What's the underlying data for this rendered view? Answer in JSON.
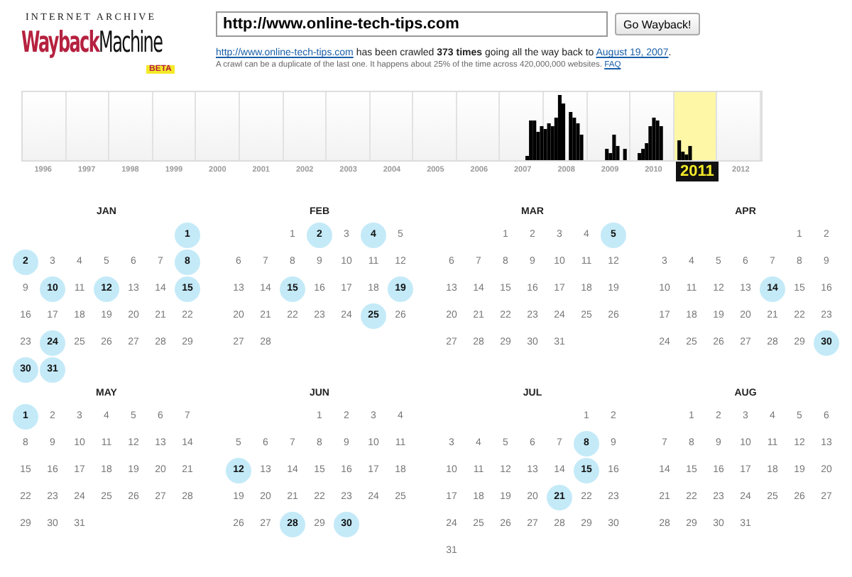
{
  "logo": {
    "top": "INTERNET ARCHIVE",
    "word_1": "Wayback",
    "word_2": "Machine",
    "badge": "BETA"
  },
  "search": {
    "value": "http://www.online-tech-tips.com",
    "button": "Go Wayback!"
  },
  "summary": {
    "url_link": "http://www.online-tech-tips.com",
    "text": " has been crawled **373 times** going all the way back to ",
    "date_link": "August 19, 2007",
    "end": "."
  },
  "note": {
    "text": "A crawl can be a duplicate of the last one. It happens about 25% of the time across 420,000,000 websites. ",
    "link": "FAQ"
  },
  "timeline": {
    "years": [
      {
        "label": "1996",
        "selected": false
      },
      {
        "label": "1997",
        "selected": false
      },
      {
        "label": "1998",
        "selected": false
      },
      {
        "label": "1999",
        "selected": false
      },
      {
        "label": "2000",
        "selected": false
      },
      {
        "label": "2001",
        "selected": false
      },
      {
        "label": "2002",
        "selected": false
      },
      {
        "label": "2003",
        "selected": false
      },
      {
        "label": "2004",
        "selected": false
      },
      {
        "label": "2005",
        "selected": false
      },
      {
        "label": "2006",
        "selected": false
      },
      {
        "label": "2007",
        "selected": false
      },
      {
        "label": "2008",
        "selected": false
      },
      {
        "label": "2009",
        "selected": false
      },
      {
        "label": "2010",
        "selected": false
      },
      {
        "label": "2011",
        "selected": true
      },
      {
        "label": "2012",
        "selected": false
      }
    ]
  },
  "months": [
    {
      "name": "JAN",
      "weeks": [
        {
          "kind": "first",
          "days": [
            {
              "day": "1",
              "crawled": true
            }
          ]
        },
        {
          "kind": "regular",
          "days": [
            {
              "day": "2",
              "crawled": true
            },
            {
              "day": "3",
              "crawled": false
            },
            {
              "day": "4",
              "crawled": false
            },
            {
              "day": "5",
              "crawled": false
            },
            {
              "day": "6",
              "crawled": false
            },
            {
              "day": "7",
              "crawled": false
            },
            {
              "day": "8",
              "crawled": true
            }
          ]
        },
        {
          "kind": "regular",
          "days": [
            {
              "day": "9",
              "crawled": false
            },
            {
              "day": "10",
              "crawled": true
            },
            {
              "day": "11",
              "crawled": false
            },
            {
              "day": "12",
              "crawled": true
            },
            {
              "day": "13",
              "crawled": false
            },
            {
              "day": "14",
              "crawled": false
            },
            {
              "day": "15",
              "crawled": true
            }
          ]
        },
        {
          "kind": "regular",
          "days": [
            {
              "day": "16",
              "crawled": false
            },
            {
              "day": "17",
              "crawled": false
            },
            {
              "day": "18",
              "crawled": false
            },
            {
              "day": "19",
              "crawled": false
            },
            {
              "day": "20",
              "crawled": false
            },
            {
              "day": "21",
              "crawled": false
            },
            {
              "day": "22",
              "crawled": false
            }
          ]
        },
        {
          "kind": "regular",
          "days": [
            {
              "day": "23",
              "crawled": false
            },
            {
              "day": "24",
              "crawled": true
            },
            {
              "day": "25",
              "crawled": false
            },
            {
              "day": "26",
              "crawled": false
            },
            {
              "day": "27",
              "crawled": false
            },
            {
              "day": "28",
              "crawled": false
            },
            {
              "day": "29",
              "crawled": false
            }
          ]
        },
        {
          "kind": "regular",
          "days": [
            {
              "day": "30",
              "crawled": true
            },
            {
              "day": "31",
              "crawled": true
            }
          ]
        }
      ]
    },
    {
      "name": "FEB",
      "weeks": [
        {
          "kind": "first",
          "days": [
            {
              "day": "1",
              "crawled": false
            },
            {
              "day": "2",
              "crawled": true
            },
            {
              "day": "3",
              "crawled": false
            },
            {
              "day": "4",
              "crawled": true
            },
            {
              "day": "5",
              "crawled": false
            }
          ]
        },
        {
          "kind": "regular",
          "days": [
            {
              "day": "6",
              "crawled": false
            },
            {
              "day": "7",
              "crawled": false
            },
            {
              "day": "8",
              "crawled": false
            },
            {
              "day": "9",
              "crawled": false
            },
            {
              "day": "10",
              "crawled": false
            },
            {
              "day": "11",
              "crawled": false
            },
            {
              "day": "12",
              "crawled": false
            }
          ]
        },
        {
          "kind": "regular",
          "days": [
            {
              "day": "13",
              "crawled": false
            },
            {
              "day": "14",
              "crawled": false
            },
            {
              "day": "15",
              "crawled": true
            },
            {
              "day": "16",
              "crawled": false
            },
            {
              "day": "17",
              "crawled": false
            },
            {
              "day": "18",
              "crawled": false
            },
            {
              "day": "19",
              "crawled": true
            }
          ]
        },
        {
          "kind": "regular",
          "days": [
            {
              "day": "20",
              "crawled": false
            },
            {
              "day": "21",
              "crawled": false
            },
            {
              "day": "22",
              "crawled": false
            },
            {
              "day": "23",
              "crawled": false
            },
            {
              "day": "24",
              "crawled": false
            },
            {
              "day": "25",
              "crawled": true
            },
            {
              "day": "26",
              "crawled": false
            }
          ]
        },
        {
          "kind": "regular",
          "days": [
            {
              "day": "27",
              "crawled": false
            },
            {
              "day": "28",
              "crawled": false
            }
          ]
        }
      ]
    },
    {
      "name": "MAR",
      "weeks": [
        {
          "kind": "first",
          "days": [
            {
              "day": "1",
              "crawled": false
            },
            {
              "day": "2",
              "crawled": false
            },
            {
              "day": "3",
              "crawled": false
            },
            {
              "day": "4",
              "crawled": false
            },
            {
              "day": "5",
              "crawled": true
            }
          ]
        },
        {
          "kind": "regular",
          "days": [
            {
              "day": "6",
              "crawled": false
            },
            {
              "day": "7",
              "crawled": false
            },
            {
              "day": "8",
              "crawled": false
            },
            {
              "day": "9",
              "crawled": false
            },
            {
              "day": "10",
              "crawled": false
            },
            {
              "day": "11",
              "crawled": false
            },
            {
              "day": "12",
              "crawled": false
            }
          ]
        },
        {
          "kind": "regular",
          "days": [
            {
              "day": "13",
              "crawled": false
            },
            {
              "day": "14",
              "crawled": false
            },
            {
              "day": "15",
              "crawled": false
            },
            {
              "day": "16",
              "crawled": false
            },
            {
              "day": "17",
              "crawled": false
            },
            {
              "day": "18",
              "crawled": false
            },
            {
              "day": "19",
              "crawled": false
            }
          ]
        },
        {
          "kind": "regular",
          "days": [
            {
              "day": "20",
              "crawled": false
            },
            {
              "day": "21",
              "crawled": false
            },
            {
              "day": "22",
              "crawled": false
            },
            {
              "day": "23",
              "crawled": false
            },
            {
              "day": "24",
              "crawled": false
            },
            {
              "day": "25",
              "crawled": false
            },
            {
              "day": "26",
              "crawled": false
            }
          ]
        },
        {
          "kind": "regular",
          "days": [
            {
              "day": "27",
              "crawled": false
            },
            {
              "day": "28",
              "crawled": false
            },
            {
              "day": "29",
              "crawled": false
            },
            {
              "day": "30",
              "crawled": false
            },
            {
              "day": "31",
              "crawled": false
            }
          ]
        }
      ]
    },
    {
      "name": "APR",
      "weeks": [
        {
          "kind": "first",
          "days": [
            {
              "day": "1",
              "crawled": false
            },
            {
              "day": "2",
              "crawled": false
            }
          ]
        },
        {
          "kind": "regular",
          "days": [
            {
              "day": "3",
              "crawled": false
            },
            {
              "day": "4",
              "crawled": false
            },
            {
              "day": "5",
              "crawled": false
            },
            {
              "day": "6",
              "crawled": false
            },
            {
              "day": "7",
              "crawled": false
            },
            {
              "day": "8",
              "crawled": false
            },
            {
              "day": "9",
              "crawled": false
            }
          ]
        },
        {
          "kind": "regular",
          "days": [
            {
              "day": "10",
              "crawled": false
            },
            {
              "day": "11",
              "crawled": false
            },
            {
              "day": "12",
              "crawled": false
            },
            {
              "day": "13",
              "crawled": false
            },
            {
              "day": "14",
              "crawled": true
            },
            {
              "day": "15",
              "crawled": false
            },
            {
              "day": "16",
              "crawled": false
            }
          ]
        },
        {
          "kind": "regular",
          "days": [
            {
              "day": "17",
              "crawled": false
            },
            {
              "day": "18",
              "crawled": false
            },
            {
              "day": "19",
              "crawled": false
            },
            {
              "day": "20",
              "crawled": false
            },
            {
              "day": "21",
              "crawled": false
            },
            {
              "day": "22",
              "crawled": false
            },
            {
              "day": "23",
              "crawled": false
            }
          ]
        },
        {
          "kind": "regular",
          "days": [
            {
              "day": "24",
              "crawled": false
            },
            {
              "day": "25",
              "crawled": false
            },
            {
              "day": "26",
              "crawled": false
            },
            {
              "day": "27",
              "crawled": false
            },
            {
              "day": "28",
              "crawled": false
            },
            {
              "day": "29",
              "crawled": false
            },
            {
              "day": "30",
              "crawled": true
            }
          ]
        }
      ]
    },
    {
      "name": "MAY",
      "weeks": [
        {
          "kind": "regular",
          "days": [
            {
              "day": "1",
              "crawled": true
            },
            {
              "day": "2",
              "crawled": false
            },
            {
              "day": "3",
              "crawled": false
            },
            {
              "day": "4",
              "crawled": false
            },
            {
              "day": "5",
              "crawled": false
            },
            {
              "day": "6",
              "crawled": false
            },
            {
              "day": "7",
              "crawled": false
            }
          ]
        },
        {
          "kind": "regular",
          "days": [
            {
              "day": "8",
              "crawled": false
            },
            {
              "day": "9",
              "crawled": false
            },
            {
              "day": "10",
              "crawled": false
            },
            {
              "day": "11",
              "crawled": false
            },
            {
              "day": "12",
              "crawled": false
            },
            {
              "day": "13",
              "crawled": false
            },
            {
              "day": "14",
              "crawled": false
            }
          ]
        },
        {
          "kind": "regular",
          "days": [
            {
              "day": "15",
              "crawled": false
            },
            {
              "day": "16",
              "crawled": false
            },
            {
              "day": "17",
              "crawled": false
            },
            {
              "day": "18",
              "crawled": false
            },
            {
              "day": "19",
              "crawled": false
            },
            {
              "day": "20",
              "crawled": false
            },
            {
              "day": "21",
              "crawled": false
            }
          ]
        },
        {
          "kind": "regular",
          "days": [
            {
              "day": "22",
              "crawled": false
            },
            {
              "day": "23",
              "crawled": false
            },
            {
              "day": "24",
              "crawled": false
            },
            {
              "day": "25",
              "crawled": false
            },
            {
              "day": "26",
              "crawled": false
            },
            {
              "day": "27",
              "crawled": false
            },
            {
              "day": "28",
              "crawled": false
            }
          ]
        },
        {
          "kind": "regular",
          "days": [
            {
              "day": "29",
              "crawled": false
            },
            {
              "day": "30",
              "crawled": false
            },
            {
              "day": "31",
              "crawled": false
            }
          ]
        }
      ]
    },
    {
      "name": "JUN",
      "weeks": [
        {
          "kind": "first",
          "days": [
            {
              "day": "1",
              "crawled": false
            },
            {
              "day": "2",
              "crawled": false
            },
            {
              "day": "3",
              "crawled": false
            },
            {
              "day": "4",
              "crawled": false
            }
          ]
        },
        {
          "kind": "regular",
          "days": [
            {
              "day": "5",
              "crawled": false
            },
            {
              "day": "6",
              "crawled": false
            },
            {
              "day": "7",
              "crawled": false
            },
            {
              "day": "8",
              "crawled": false
            },
            {
              "day": "9",
              "crawled": false
            },
            {
              "day": "10",
              "crawled": false
            },
            {
              "day": "11",
              "crawled": false
            }
          ]
        },
        {
          "kind": "regular",
          "days": [
            {
              "day": "12",
              "crawled": true
            },
            {
              "day": "13",
              "crawled": false
            },
            {
              "day": "14",
              "crawled": false
            },
            {
              "day": "15",
              "crawled": false
            },
            {
              "day": "16",
              "crawled": false
            },
            {
              "day": "17",
              "crawled": false
            },
            {
              "day": "18",
              "crawled": false
            }
          ]
        },
        {
          "kind": "regular",
          "days": [
            {
              "day": "19",
              "crawled": false
            },
            {
              "day": "20",
              "crawled": false
            },
            {
              "day": "21",
              "crawled": false
            },
            {
              "day": "22",
              "crawled": false
            },
            {
              "day": "23",
              "crawled": false
            },
            {
              "day": "24",
              "crawled": false
            },
            {
              "day": "25",
              "crawled": false
            }
          ]
        },
        {
          "kind": "regular",
          "days": [
            {
              "day": "26",
              "crawled": false
            },
            {
              "day": "27",
              "crawled": false
            },
            {
              "day": "28",
              "crawled": true
            },
            {
              "day": "29",
              "crawled": false
            },
            {
              "day": "30",
              "crawled": true
            }
          ]
        }
      ]
    },
    {
      "name": "JUL",
      "weeks": [
        {
          "kind": "first",
          "days": [
            {
              "day": "1",
              "crawled": false
            },
            {
              "day": "2",
              "crawled": false
            }
          ]
        },
        {
          "kind": "regular",
          "days": [
            {
              "day": "3",
              "crawled": false
            },
            {
              "day": "4",
              "crawled": false
            },
            {
              "day": "5",
              "crawled": false
            },
            {
              "day": "6",
              "crawled": false
            },
            {
              "day": "7",
              "crawled": false
            },
            {
              "day": "8",
              "crawled": true
            },
            {
              "day": "9",
              "crawled": false
            }
          ]
        },
        {
          "kind": "regular",
          "days": [
            {
              "day": "10",
              "crawled": false
            },
            {
              "day": "11",
              "crawled": false
            },
            {
              "day": "12",
              "crawled": false
            },
            {
              "day": "13",
              "crawled": false
            },
            {
              "day": "14",
              "crawled": false
            },
            {
              "day": "15",
              "crawled": true
            },
            {
              "day": "16",
              "crawled": false
            }
          ]
        },
        {
          "kind": "regular",
          "days": [
            {
              "day": "17",
              "crawled": false
            },
            {
              "day": "18",
              "crawled": false
            },
            {
              "day": "19",
              "crawled": false
            },
            {
              "day": "20",
              "crawled": false
            },
            {
              "day": "21",
              "crawled": true
            },
            {
              "day": "22",
              "crawled": false
            },
            {
              "day": "23",
              "crawled": false
            }
          ]
        },
        {
          "kind": "regular",
          "days": [
            {
              "day": "24",
              "crawled": false
            },
            {
              "day": "25",
              "crawled": false
            },
            {
              "day": "26",
              "crawled": false
            },
            {
              "day": "27",
              "crawled": false
            },
            {
              "day": "28",
              "crawled": false
            },
            {
              "day": "29",
              "crawled": false
            },
            {
              "day": "30",
              "crawled": false
            }
          ]
        },
        {
          "kind": "regular",
          "days": [
            {
              "day": "31",
              "crawled": false
            }
          ]
        }
      ]
    },
    {
      "name": "AUG",
      "weeks": [
        {
          "kind": "first",
          "days": [
            {
              "day": "1",
              "crawled": false
            },
            {
              "day": "2",
              "crawled": false
            },
            {
              "day": "3",
              "crawled": false
            },
            {
              "day": "4",
              "crawled": false
            },
            {
              "day": "5",
              "crawled": false
            },
            {
              "day": "6",
              "crawled": false
            }
          ]
        },
        {
          "kind": "regular",
          "days": [
            {
              "day": "7",
              "crawled": false
            },
            {
              "day": "8",
              "crawled": false
            },
            {
              "day": "9",
              "crawled": false
            },
            {
              "day": "10",
              "crawled": false
            },
            {
              "day": "11",
              "crawled": false
            },
            {
              "day": "12",
              "crawled": false
            },
            {
              "day": "13",
              "crawled": false
            }
          ]
        },
        {
          "kind": "regular",
          "days": [
            {
              "day": "14",
              "crawled": false
            },
            {
              "day": "15",
              "crawled": false
            },
            {
              "day": "16",
              "crawled": false
            },
            {
              "day": "17",
              "crawled": false
            },
            {
              "day": "18",
              "crawled": false
            },
            {
              "day": "19",
              "crawled": false
            },
            {
              "day": "20",
              "crawled": false
            }
          ]
        },
        {
          "kind": "regular",
          "days": [
            {
              "day": "21",
              "crawled": false
            },
            {
              "day": "22",
              "crawled": false
            },
            {
              "day": "23",
              "crawled": false
            },
            {
              "day": "24",
              "crawled": false
            },
            {
              "day": "25",
              "crawled": false
            },
            {
              "day": "26",
              "crawled": false
            },
            {
              "day": "27",
              "crawled": false
            }
          ]
        },
        {
          "kind": "regular",
          "days": [
            {
              "day": "28",
              "crawled": false
            },
            {
              "day": "29",
              "crawled": false
            },
            {
              "day": "30",
              "crawled": false
            },
            {
              "day": "31",
              "crawled": false
            }
          ]
        }
      ]
    }
  ]
}
